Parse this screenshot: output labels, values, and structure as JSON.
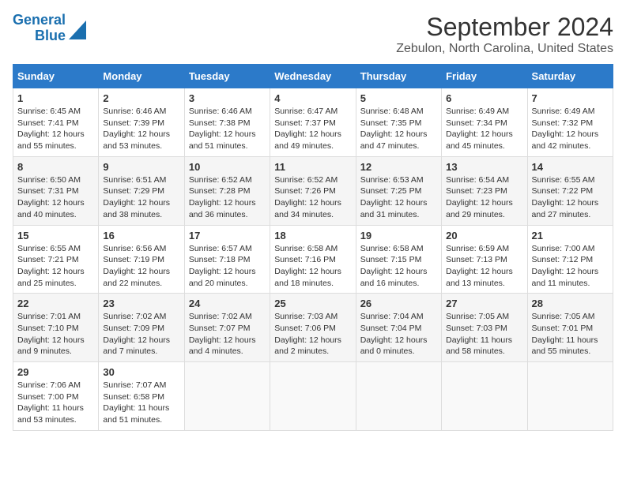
{
  "header": {
    "logo_line1": "General",
    "logo_line2": "Blue",
    "title": "September 2024",
    "subtitle": "Zebulon, North Carolina, United States"
  },
  "columns": [
    "Sunday",
    "Monday",
    "Tuesday",
    "Wednesday",
    "Thursday",
    "Friday",
    "Saturday"
  ],
  "weeks": [
    [
      {
        "day": "1",
        "info": "Sunrise: 6:45 AM\nSunset: 7:41 PM\nDaylight: 12 hours\nand 55 minutes."
      },
      {
        "day": "2",
        "info": "Sunrise: 6:46 AM\nSunset: 7:39 PM\nDaylight: 12 hours\nand 53 minutes."
      },
      {
        "day": "3",
        "info": "Sunrise: 6:46 AM\nSunset: 7:38 PM\nDaylight: 12 hours\nand 51 minutes."
      },
      {
        "day": "4",
        "info": "Sunrise: 6:47 AM\nSunset: 7:37 PM\nDaylight: 12 hours\nand 49 minutes."
      },
      {
        "day": "5",
        "info": "Sunrise: 6:48 AM\nSunset: 7:35 PM\nDaylight: 12 hours\nand 47 minutes."
      },
      {
        "day": "6",
        "info": "Sunrise: 6:49 AM\nSunset: 7:34 PM\nDaylight: 12 hours\nand 45 minutes."
      },
      {
        "day": "7",
        "info": "Sunrise: 6:49 AM\nSunset: 7:32 PM\nDaylight: 12 hours\nand 42 minutes."
      }
    ],
    [
      {
        "day": "8",
        "info": "Sunrise: 6:50 AM\nSunset: 7:31 PM\nDaylight: 12 hours\nand 40 minutes."
      },
      {
        "day": "9",
        "info": "Sunrise: 6:51 AM\nSunset: 7:29 PM\nDaylight: 12 hours\nand 38 minutes."
      },
      {
        "day": "10",
        "info": "Sunrise: 6:52 AM\nSunset: 7:28 PM\nDaylight: 12 hours\nand 36 minutes."
      },
      {
        "day": "11",
        "info": "Sunrise: 6:52 AM\nSunset: 7:26 PM\nDaylight: 12 hours\nand 34 minutes."
      },
      {
        "day": "12",
        "info": "Sunrise: 6:53 AM\nSunset: 7:25 PM\nDaylight: 12 hours\nand 31 minutes."
      },
      {
        "day": "13",
        "info": "Sunrise: 6:54 AM\nSunset: 7:23 PM\nDaylight: 12 hours\nand 29 minutes."
      },
      {
        "day": "14",
        "info": "Sunrise: 6:55 AM\nSunset: 7:22 PM\nDaylight: 12 hours\nand 27 minutes."
      }
    ],
    [
      {
        "day": "15",
        "info": "Sunrise: 6:55 AM\nSunset: 7:21 PM\nDaylight: 12 hours\nand 25 minutes."
      },
      {
        "day": "16",
        "info": "Sunrise: 6:56 AM\nSunset: 7:19 PM\nDaylight: 12 hours\nand 22 minutes."
      },
      {
        "day": "17",
        "info": "Sunrise: 6:57 AM\nSunset: 7:18 PM\nDaylight: 12 hours\nand 20 minutes."
      },
      {
        "day": "18",
        "info": "Sunrise: 6:58 AM\nSunset: 7:16 PM\nDaylight: 12 hours\nand 18 minutes."
      },
      {
        "day": "19",
        "info": "Sunrise: 6:58 AM\nSunset: 7:15 PM\nDaylight: 12 hours\nand 16 minutes."
      },
      {
        "day": "20",
        "info": "Sunrise: 6:59 AM\nSunset: 7:13 PM\nDaylight: 12 hours\nand 13 minutes."
      },
      {
        "day": "21",
        "info": "Sunrise: 7:00 AM\nSunset: 7:12 PM\nDaylight: 12 hours\nand 11 minutes."
      }
    ],
    [
      {
        "day": "22",
        "info": "Sunrise: 7:01 AM\nSunset: 7:10 PM\nDaylight: 12 hours\nand 9 minutes."
      },
      {
        "day": "23",
        "info": "Sunrise: 7:02 AM\nSunset: 7:09 PM\nDaylight: 12 hours\nand 7 minutes."
      },
      {
        "day": "24",
        "info": "Sunrise: 7:02 AM\nSunset: 7:07 PM\nDaylight: 12 hours\nand 4 minutes."
      },
      {
        "day": "25",
        "info": "Sunrise: 7:03 AM\nSunset: 7:06 PM\nDaylight: 12 hours\nand 2 minutes."
      },
      {
        "day": "26",
        "info": "Sunrise: 7:04 AM\nSunset: 7:04 PM\nDaylight: 12 hours\nand 0 minutes."
      },
      {
        "day": "27",
        "info": "Sunrise: 7:05 AM\nSunset: 7:03 PM\nDaylight: 11 hours\nand 58 minutes."
      },
      {
        "day": "28",
        "info": "Sunrise: 7:05 AM\nSunset: 7:01 PM\nDaylight: 11 hours\nand 55 minutes."
      }
    ],
    [
      {
        "day": "29",
        "info": "Sunrise: 7:06 AM\nSunset: 7:00 PM\nDaylight: 11 hours\nand 53 minutes."
      },
      {
        "day": "30",
        "info": "Sunrise: 7:07 AM\nSunset: 6:58 PM\nDaylight: 11 hours\nand 51 minutes."
      },
      {
        "day": "",
        "info": ""
      },
      {
        "day": "",
        "info": ""
      },
      {
        "day": "",
        "info": ""
      },
      {
        "day": "",
        "info": ""
      },
      {
        "day": "",
        "info": ""
      }
    ]
  ]
}
